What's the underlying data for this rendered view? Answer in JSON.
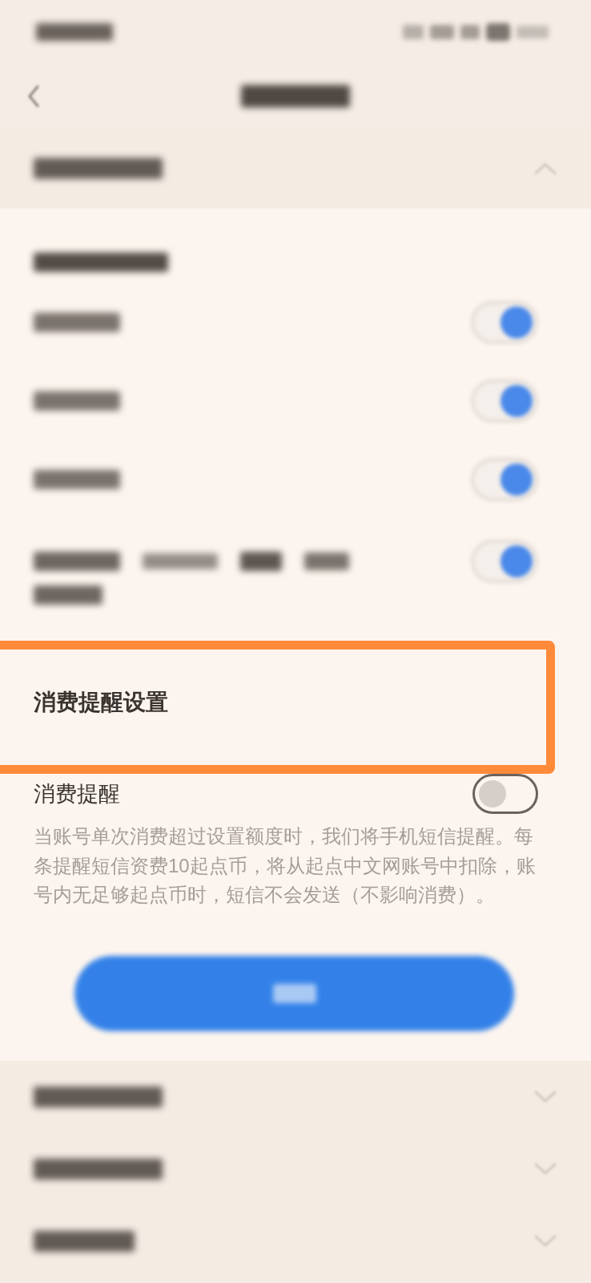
{
  "sections": [
    {
      "expanded": true,
      "switch_rows": [
        {
          "kind": "single",
          "on": true
        },
        {
          "kind": "single",
          "on": true
        },
        {
          "kind": "single",
          "on": true
        },
        {
          "kind": "double",
          "on": true
        }
      ],
      "reminder": {
        "title": "消费提醒设置",
        "label": "消费提醒",
        "on": false,
        "description": "当账号单次消费超过设置额度时，我们将手机短信提醒。每条提醒短信资费10起点币，将从起点中文网账号中扣除，账号内无足够起点币时，短信不会发送（不影响消费）。"
      }
    },
    {
      "expanded": false
    },
    {
      "expanded": false
    },
    {
      "expanded": false
    }
  ]
}
